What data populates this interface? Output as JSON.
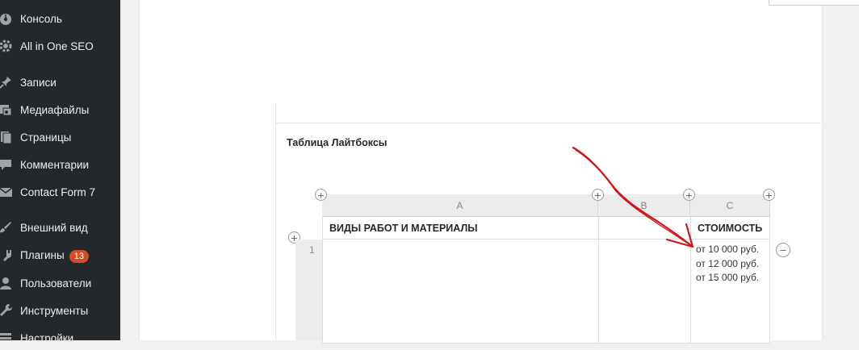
{
  "sidebar": {
    "items": [
      {
        "label": "Консоль",
        "icon": "dashboard-icon"
      },
      {
        "label": "All in One SEO",
        "icon": "gear-icon"
      },
      {
        "label": "Записи",
        "icon": "pin-icon"
      },
      {
        "label": "Медиафайлы",
        "icon": "media-icon"
      },
      {
        "label": "Страницы",
        "icon": "pages-icon"
      },
      {
        "label": "Комментарии",
        "icon": "comment-icon"
      },
      {
        "label": "Contact Form 7",
        "icon": "envelope-icon"
      },
      {
        "label": "Внешний вид",
        "icon": "brush-icon"
      },
      {
        "label": "Плагины",
        "icon": "plugin-icon",
        "badge": "13"
      },
      {
        "label": "Пользователи",
        "icon": "user-icon"
      },
      {
        "label": "Инструменты",
        "icon": "wrench-icon"
      },
      {
        "label": "Настройки",
        "icon": "settings-icon"
      }
    ]
  },
  "main": {
    "section_title": "Таблица Лайтбоксы",
    "table": {
      "column_letters": [
        "A",
        "B",
        "C"
      ],
      "headers": [
        "ВИДЫ РАБОТ И МАТЕРИАЛЫ",
        "",
        "СТОИМОСТЬ"
      ],
      "rows": [
        {
          "number": "1",
          "cells": [
            "",
            "",
            "от 10 000 руб. от 12 000 руб. от 15 000 руб."
          ]
        }
      ],
      "add_symbol": "+",
      "remove_symbol": "−"
    }
  },
  "colors": {
    "sidebar_bg": "#23282d",
    "badge_bg": "#d54e21",
    "annotation_arrow": "#d11414"
  }
}
